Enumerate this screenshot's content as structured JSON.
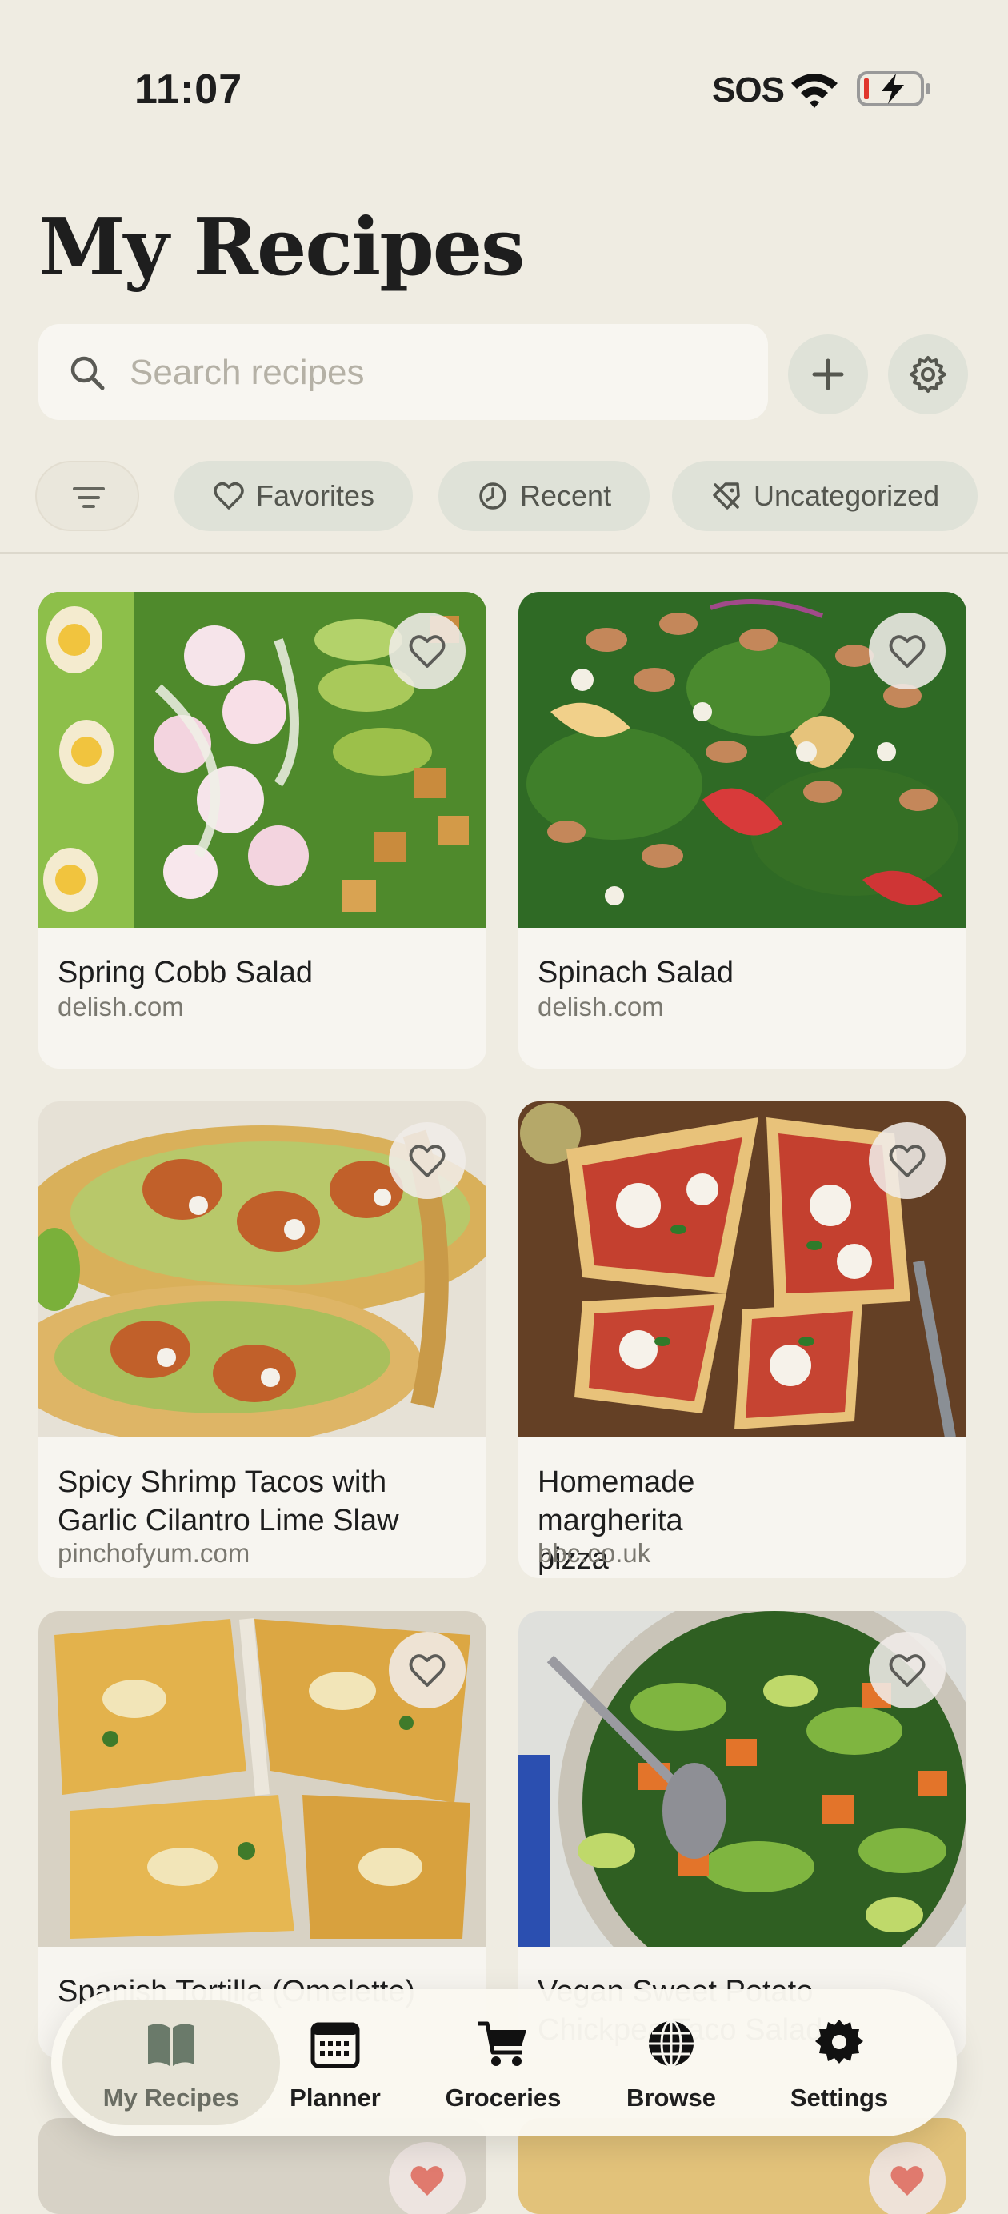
{
  "status": {
    "time": "11:07",
    "sos": "SOS"
  },
  "header": {
    "title": "My Recipes"
  },
  "search": {
    "placeholder": "Search recipes"
  },
  "filters": {
    "chips": [
      "Favorites",
      "Recent",
      "Uncategorized"
    ]
  },
  "recipes": [
    {
      "name": "Spring Cobb Salad",
      "site": "delish.com"
    },
    {
      "name": "Spinach Salad",
      "site": "delish.com"
    },
    {
      "name": "Spicy Shrimp Tacos with Garlic Cilantro Lime Slaw",
      "site": "pinchofyum.com"
    },
    {
      "name": "Homemade margherita pizza",
      "site": "bbc.co.uk"
    },
    {
      "name": "Spanish Tortilla (Omelette)",
      "site": ""
    },
    {
      "name": "Vegan Sweet Potato Chickpea Taco Salad",
      "site": ""
    }
  ],
  "tabbar": {
    "tabs": [
      "My Recipes",
      "Planner",
      "Groceries",
      "Browse",
      "Settings"
    ],
    "active": "My Recipes"
  },
  "colors": {
    "background": "#efece2",
    "chip": "#dfe2d8",
    "card": "#f7f5f0",
    "muted_text": "#7a7870"
  }
}
